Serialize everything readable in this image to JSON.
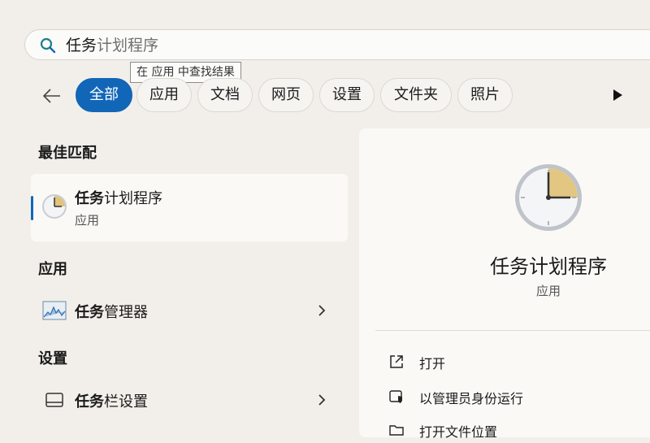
{
  "search": {
    "query_bold": "任务",
    "query_rest": "计划程序",
    "tooltip": "在 应用 中查找结果"
  },
  "filters": [
    {
      "label": "全部",
      "active": true
    },
    {
      "label": "应用",
      "active": false
    },
    {
      "label": "文档",
      "active": false
    },
    {
      "label": "网页",
      "active": false
    },
    {
      "label": "设置",
      "active": false
    },
    {
      "label": "文件夹",
      "active": false
    },
    {
      "label": "照片",
      "active": false
    }
  ],
  "best_match": {
    "heading": "最佳匹配",
    "name_bold": "任务",
    "name_rest": "计划程序",
    "type": "应用"
  },
  "apps_section": {
    "heading": "应用",
    "items": [
      {
        "name_bold": "任务",
        "name_rest": "管理器"
      }
    ]
  },
  "settings_section": {
    "heading": "设置",
    "items": [
      {
        "name_bold": "任务",
        "name_rest": "栏设置"
      }
    ]
  },
  "detail": {
    "name": "任务计划程序",
    "type": "应用",
    "actions": [
      {
        "label": "打开",
        "icon": "open-external-icon"
      },
      {
        "label": "以管理员身份运行",
        "icon": "shield-icon"
      },
      {
        "label": "打开文件位置",
        "icon": "folder-icon"
      }
    ]
  },
  "colors": {
    "accent": "#1266b8",
    "background": "#f2efea",
    "card": "#faf9f6"
  }
}
